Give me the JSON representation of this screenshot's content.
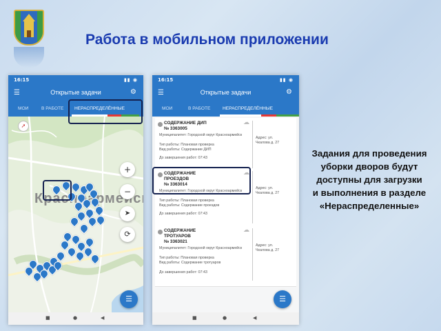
{
  "page": {
    "title": "Работа в мобильном приложении",
    "caption_lines": [
      "Задания для проведения",
      "уборки дворов будут",
      "доступны для загрузки",
      "и выполнения в разделе",
      "«Нераспределенные»"
    ]
  },
  "phone_map": {
    "status_time": "16:15",
    "appbar_title": "Открытые задачи",
    "tabs": [
      "МОИ",
      "В РАБОТЕ",
      "НЕРАСПРЕДЕЛЁННЫЕ"
    ],
    "active_tab": "НЕРАСПРЕДЕЛЁННЫЕ",
    "map_label": "Красноармейск",
    "zoom_in": "+",
    "zoom_out": "−"
  },
  "phone_list": {
    "status_time": "16:15",
    "appbar_title": "Открытые задачи",
    "tabs": [
      "МОИ",
      "В РАБОТЕ",
      "НЕРАСПРЕДЕЛЁННЫЕ"
    ],
    "active_tab": "НЕРАСПРЕДЕЛЁННЫЕ",
    "tasks": [
      {
        "title": "СОДЕРЖАНИЕ ДИП",
        "number": "№ 3363005",
        "municipality": "Муниципалитет: Городской округ Красноармейск",
        "task_type": "Тип работы: Плановая проверка",
        "work_kind": "Вид работы: Содержание ДИП",
        "address": "Адрес: ул. Чкалова д. 27",
        "deadline": "До завершения работ: 07:43"
      },
      {
        "title": "СОДЕРЖАНИЕ ПРОЕЗДОВ",
        "number": "№ 3363014",
        "municipality": "Муниципалитет: Городской округ Красноармейск",
        "task_type": "Тип работы: Плановая проверка",
        "work_kind": "Вид работы: Содержание проездов",
        "address": "Адрес: ул. Чкалова д. 27",
        "deadline": "До завершения работ: 07:43"
      },
      {
        "title": "СОДЕРЖАНИЕ ТРОТУАРОВ",
        "number": "№ 3363021",
        "municipality": "Муниципалитет: Городской округ Красноармейск",
        "task_type": "Тип работы: Плановая проверка",
        "work_kind": "Вид работы: Содержание тротуаров",
        "address": "Адрес: ул. Чкалова д. 27",
        "deadline": "До завершения работ: 07:43"
      }
    ]
  },
  "colors": {
    "title": "#1a3bb0",
    "app_bar": "#2b78c8",
    "marker": "#2b78c8",
    "highlight_box": "#14214f",
    "tab_underline_red": "#e53935",
    "tab_underline_green": "#43a047"
  },
  "icons": [
    "menu-icon",
    "filter-icon",
    "zoom-in-icon",
    "zoom-out-icon",
    "locate-icon",
    "refresh-icon",
    "list-view-icon",
    "compass-icon",
    "map-marker-icon",
    "cloud-icon",
    "back-icon",
    "home-icon",
    "recents-icon"
  ]
}
